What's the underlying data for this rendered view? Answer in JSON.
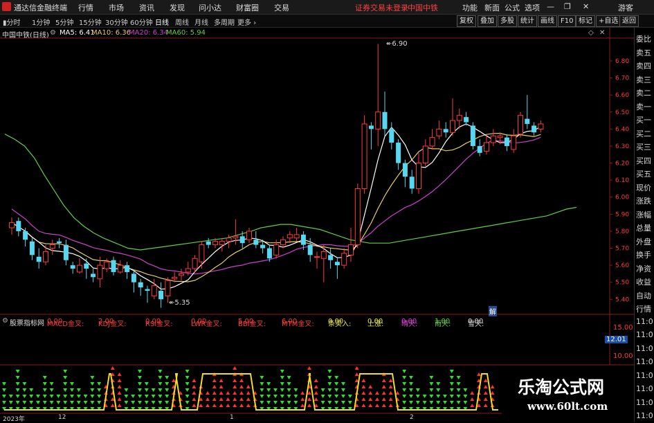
{
  "app": {
    "title": "通达信金融终端"
  },
  "menu": {
    "items": [
      "行情",
      "市场",
      "资讯",
      "发现",
      "问小达",
      "财富圈",
      "交易"
    ],
    "status": "证券交易未登录",
    "stock": "中国中铁",
    "right_items": [
      "功能",
      "新面",
      "公式",
      "选项"
    ],
    "guest": "游客"
  },
  "periods": [
    "分时",
    "1分钟",
    "5分钟",
    "15分钟",
    "30分钟",
    "60分钟",
    "日线",
    "周线",
    "月线",
    "多周期",
    "更多"
  ],
  "active_period": "日线",
  "toolbar": [
    "复权",
    "叠加",
    "多股",
    "统计",
    "画线",
    "F10",
    "标记",
    "+自选",
    "返回"
  ],
  "info": {
    "name": "中国中铁(日线)",
    "ma5": "MA5: 6.41",
    "ma10": "MA10: 6.36",
    "ma20": "MA20: 6.34",
    "ma60": "MA60: 5.94"
  },
  "price_axis": [
    "6.80",
    "6.70",
    "6.60",
    "6.50",
    "6.40",
    "6.30",
    "6.20",
    "6.10",
    "6.00",
    "5.90",
    "5.80",
    "5.70",
    "5.60",
    "5.50",
    "5.40"
  ],
  "annotations": {
    "high": "6.90",
    "low": "5.35",
    "marker": "解"
  },
  "indicator": {
    "name": "股票指标网",
    "items": [
      {
        "label": "MACD金叉:",
        "value": "0.00"
      },
      {
        "label": "KDJ金叉:",
        "value": "2.00"
      },
      {
        "label": "RSI金叉:",
        "value": "0.00"
      },
      {
        "label": "LWR金叉:",
        "value": "0.00"
      },
      {
        "label": "BBI金叉:",
        "value": "5.00"
      },
      {
        "label": "MTM金叉:",
        "value": "6.00"
      },
      {
        "label": "条买入:",
        "value": "0.00"
      },
      {
        "label": "上涨:",
        "value": "0.00"
      },
      {
        "label": "晴天:",
        "value": "0.00"
      },
      {
        "label": "雨天:",
        "value": "1.00"
      },
      {
        "label": "雪天:",
        "value": "0.00"
      }
    ],
    "axis": [
      "15.00",
      "12.01",
      "10.00"
    ]
  },
  "right_panel": [
    "委比",
    "卖五",
    "卖四",
    "卖三",
    "卖二",
    "卖一",
    "买一",
    "买二",
    "买三",
    "买四",
    "买五",
    "现价",
    "涨跌",
    "涨幅",
    "总量",
    "外盘",
    "换手",
    "净资",
    "收益",
    "自动",
    "行情",
    "11:0",
    "11:0",
    "11:0",
    "11:0",
    "11:0",
    "11:0",
    "11:0",
    "11:0"
  ],
  "dates": {
    "year": "2023年",
    "m1": "12",
    "m2": "1",
    "m3": "2"
  },
  "watermark": {
    "cn": "乐淘公式网",
    "url": "www.60lt.com"
  },
  "colors": {
    "up": "#ff3b3b",
    "down": "#58d8f0",
    "ma5": "#ffffff",
    "ma10": "#e6cc66",
    "ma20": "#d040d0",
    "ma60": "#60d040"
  },
  "chart_data": {
    "type": "candlestick",
    "title": "中国中铁(日线)",
    "ylim": [
      5.32,
      6.93
    ],
    "candles": [
      [
        5.82,
        5.85,
        5.88,
        5.78
      ],
      [
        5.86,
        5.8,
        5.88,
        5.77
      ],
      [
        5.8,
        5.75,
        5.82,
        5.71
      ],
      [
        5.74,
        5.66,
        5.76,
        5.63
      ],
      [
        5.65,
        5.62,
        5.7,
        5.58
      ],
      [
        5.62,
        5.68,
        5.72,
        5.6
      ],
      [
        5.7,
        5.72,
        5.75,
        5.66
      ],
      [
        5.74,
        5.73,
        5.76,
        5.7
      ],
      [
        5.72,
        5.63,
        5.75,
        5.6
      ],
      [
        5.6,
        5.58,
        5.62,
        5.55
      ],
      [
        5.56,
        5.6,
        5.64,
        5.55
      ],
      [
        5.61,
        5.58,
        5.64,
        5.52
      ],
      [
        5.55,
        5.53,
        5.58,
        5.5
      ],
      [
        5.52,
        5.6,
        5.65,
        5.47
      ],
      [
        5.58,
        5.62,
        5.64,
        5.56
      ],
      [
        5.63,
        5.56,
        5.65,
        5.54
      ],
      [
        5.56,
        5.6,
        5.63,
        5.55
      ],
      [
        5.6,
        5.56,
        5.62,
        5.52
      ],
      [
        5.55,
        5.5,
        5.57,
        5.44
      ],
      [
        5.5,
        5.47,
        5.52,
        5.42
      ],
      [
        5.46,
        5.45,
        5.48,
        5.38
      ],
      [
        5.42,
        5.48,
        5.52,
        5.4
      ],
      [
        5.45,
        5.4,
        5.5,
        5.35
      ],
      [
        5.42,
        5.51,
        5.53,
        5.38
      ],
      [
        5.52,
        5.53,
        5.56,
        5.5
      ],
      [
        5.54,
        5.55,
        5.58,
        5.51
      ],
      [
        5.56,
        5.58,
        5.62,
        5.54
      ],
      [
        5.58,
        5.64,
        5.66,
        5.56
      ],
      [
        5.62,
        5.72,
        5.74,
        5.58
      ],
      [
        5.74,
        5.72,
        5.76,
        5.7
      ],
      [
        5.72,
        5.74,
        5.76,
        5.7
      ],
      [
        5.72,
        5.74,
        5.76,
        5.68
      ],
      [
        5.74,
        5.76,
        5.78,
        5.7
      ],
      [
        5.76,
        5.77,
        5.87,
        5.72
      ],
      [
        5.77,
        5.73,
        5.8,
        5.7
      ],
      [
        5.75,
        5.8,
        5.82,
        5.73
      ],
      [
        5.75,
        5.72,
        5.8,
        5.7
      ],
      [
        5.72,
        5.7,
        5.75,
        5.67
      ],
      [
        5.7,
        5.64,
        5.72,
        5.62
      ],
      [
        5.66,
        5.72,
        5.75,
        5.64
      ],
      [
        5.72,
        5.75,
        5.77,
        5.7
      ],
      [
        5.76,
        5.78,
        5.8,
        5.73
      ],
      [
        5.76,
        5.78,
        5.82,
        5.74
      ],
      [
        5.78,
        5.72,
        5.8,
        5.69
      ],
      [
        5.72,
        5.66,
        5.76,
        5.62
      ],
      [
        5.65,
        5.65,
        5.68,
        5.58
      ],
      [
        5.64,
        5.68,
        5.72,
        5.5
      ],
      [
        5.66,
        5.63,
        5.7,
        5.58
      ],
      [
        5.62,
        5.6,
        5.64,
        5.52
      ],
      [
        5.6,
        5.67,
        5.7,
        5.58
      ],
      [
        5.66,
        5.72,
        5.82,
        5.62
      ],
      [
        5.72,
        6.05,
        6.08,
        5.7
      ],
      [
        6.05,
        6.43,
        6.48,
        6.02
      ],
      [
        6.42,
        6.4,
        6.44,
        6.28
      ],
      [
        6.4,
        6.5,
        6.9,
        6.3
      ],
      [
        6.5,
        6.4,
        6.62,
        6.36
      ],
      [
        6.4,
        6.32,
        6.44,
        6.28
      ],
      [
        6.32,
        6.2,
        6.34,
        6.16
      ],
      [
        6.2,
        6.12,
        6.22,
        6.06
      ],
      [
        6.12,
        6.05,
        6.16,
        6.02
      ],
      [
        6.05,
        6.2,
        6.26,
        6.02
      ],
      [
        6.2,
        6.3,
        6.34,
        6.18
      ],
      [
        6.3,
        6.35,
        6.4,
        6.28
      ],
      [
        6.36,
        6.4,
        6.45,
        6.34
      ],
      [
        6.4,
        6.38,
        6.44,
        6.35
      ],
      [
        6.38,
        6.45,
        6.58,
        6.36
      ],
      [
        6.45,
        6.48,
        6.52,
        6.4
      ],
      [
        6.47,
        6.44,
        6.5,
        6.42
      ],
      [
        6.42,
        6.3,
        6.44,
        6.28
      ],
      [
        6.3,
        6.26,
        6.34,
        6.24
      ],
      [
        6.27,
        6.32,
        6.36,
        6.25
      ],
      [
        6.32,
        6.36,
        6.4,
        6.3
      ],
      [
        6.35,
        6.36,
        6.38,
        6.31
      ],
      [
        6.35,
        6.3,
        6.37,
        6.27
      ],
      [
        6.28,
        6.36,
        6.4,
        6.26
      ],
      [
        6.37,
        6.48,
        6.5,
        6.35
      ],
      [
        6.46,
        6.43,
        6.6,
        6.4
      ],
      [
        6.42,
        6.38,
        6.44,
        6.36
      ],
      [
        6.4,
        6.43,
        6.45,
        6.38
      ]
    ],
    "ma60": [
      [
        0,
        6.37
      ],
      [
        8,
        6.34
      ],
      [
        16,
        6.3
      ],
      [
        24,
        6.23
      ],
      [
        32,
        6.13
      ],
      [
        40,
        6.04
      ],
      [
        48,
        5.95
      ],
      [
        56,
        5.88
      ],
      [
        64,
        5.83
      ],
      [
        72,
        5.79
      ],
      [
        80,
        5.76
      ],
      [
        90,
        5.73
      ],
      [
        100,
        5.7
      ],
      [
        110,
        5.69
      ],
      [
        120,
        5.7
      ],
      [
        130,
        5.71
      ],
      [
        140,
        5.72
      ],
      [
        150,
        5.73
      ],
      [
        160,
        5.74
      ],
      [
        170,
        5.75
      ],
      [
        180,
        5.76
      ],
      [
        190,
        5.78
      ],
      [
        200,
        5.8
      ],
      [
        208,
        5.82
      ],
      [
        216,
        5.83
      ],
      [
        224,
        5.84
      ],
      [
        232,
        5.84
      ],
      [
        240,
        5.83
      ],
      [
        248,
        5.82
      ],
      [
        256,
        5.81
      ],
      [
        264,
        5.79
      ],
      [
        272,
        5.77
      ],
      [
        280,
        5.75
      ],
      [
        288,
        5.74
      ],
      [
        296,
        5.73
      ],
      [
        304,
        5.73
      ],
      [
        312,
        5.73
      ],
      [
        320,
        5.74
      ],
      [
        328,
        5.75
      ],
      [
        336,
        5.76
      ],
      [
        344,
        5.77
      ],
      [
        352,
        5.78
      ],
      [
        360,
        5.79
      ],
      [
        368,
        5.8
      ],
      [
        376,
        5.81
      ],
      [
        384,
        5.82
      ],
      [
        392,
        5.83
      ],
      [
        400,
        5.84
      ],
      [
        408,
        5.85
      ],
      [
        416,
        5.86
      ],
      [
        424,
        5.87
      ],
      [
        432,
        5.88
      ],
      [
        440,
        5.89
      ],
      [
        448,
        5.91
      ],
      [
        456,
        5.93
      ],
      [
        464,
        5.94
      ]
    ]
  }
}
